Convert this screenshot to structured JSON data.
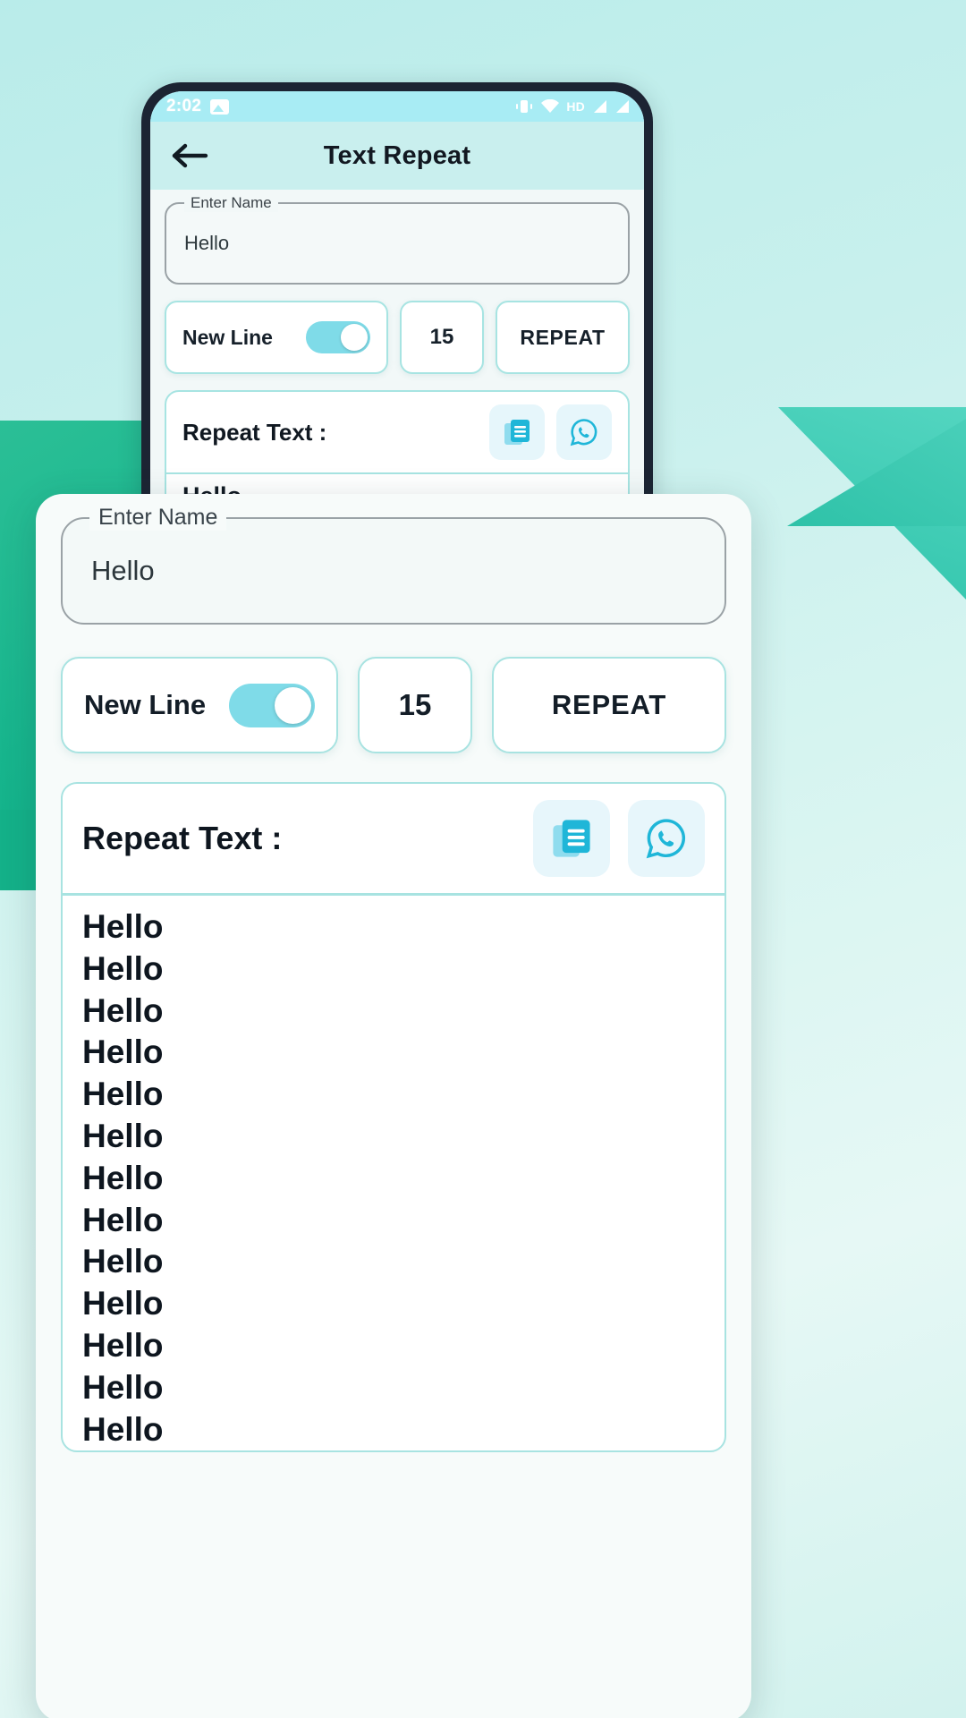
{
  "status_bar": {
    "time": "2:02",
    "hd_label": "HD",
    "icons": [
      "image-icon",
      "vibrate-icon",
      "wifi-icon",
      "hd-icon",
      "signal-icon",
      "signal2-icon"
    ]
  },
  "app_bar": {
    "back_icon": "arrow-left-icon",
    "title": "Text Repeat"
  },
  "form": {
    "name_field": {
      "label": "Enter Name",
      "value": "Hello"
    }
  },
  "controls": {
    "newline": {
      "label": "New Line",
      "toggle_state": "on"
    },
    "count": {
      "value": "15"
    },
    "repeat_button": {
      "label": "REPEAT"
    }
  },
  "result": {
    "title": "Repeat Text :",
    "actions": [
      {
        "name": "copy-icon",
        "label": "Copy"
      },
      {
        "name": "whatsapp-icon",
        "label": "Share on WhatsApp"
      }
    ],
    "lines_phone": [
      "Hello"
    ],
    "lines": [
      "Hello",
      "Hello",
      "Hello",
      "Hello",
      "Hello",
      "Hello",
      "Hello",
      "Hello",
      "Hello",
      "Hello",
      "Hello",
      "Hello",
      "Hello"
    ]
  },
  "colors": {
    "accent": "#7fdbe8",
    "border": "#a8e3e1",
    "appbar": "#c9efee",
    "statusbar": "#a8ecf4",
    "text": "#0e161f",
    "background": "#bfeeee",
    "green": "#14b189",
    "icon_blue": "#1fb6d8"
  }
}
